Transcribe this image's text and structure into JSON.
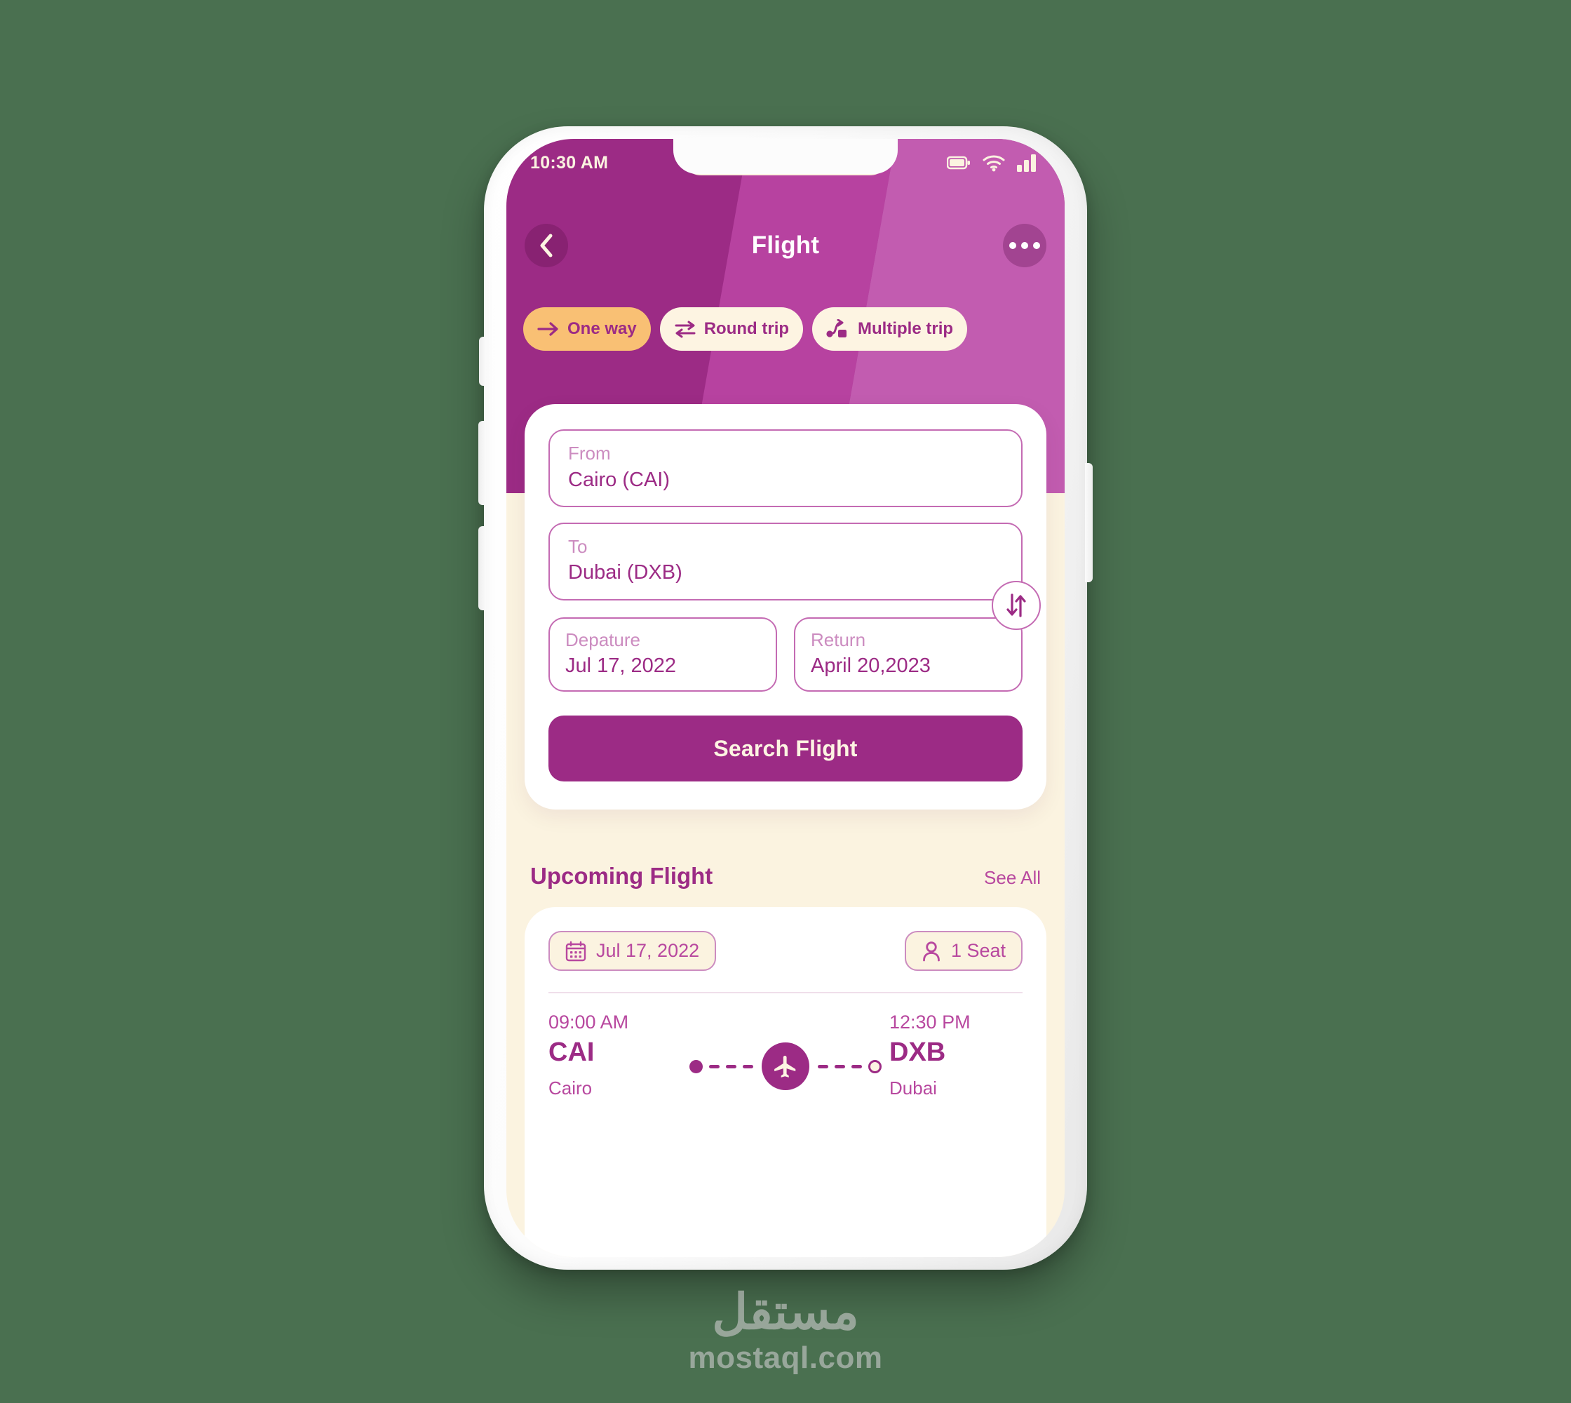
{
  "theme": {
    "page_bg": "#4a7050",
    "primary_purple": "#9c2b85",
    "band_mid": "#b742a0",
    "band_light": "#c25cb0",
    "cream": "#fbf3e0",
    "accent_orange": "#f9c074",
    "text_light_purple": "#cc8cc0"
  },
  "status_bar": {
    "time": "10:30 AM",
    "battery_icon": "battery-icon",
    "wifi_icon": "wifi-icon",
    "signal_icon": "signal-icon"
  },
  "header": {
    "back_icon": "chevron-left-icon",
    "title": "Flight",
    "menu_icon": "more-options-icon"
  },
  "trip_tabs": [
    {
      "label": "One way",
      "icon": "arrow-right-icon",
      "active": true
    },
    {
      "label": "Round trip",
      "icon": "round-trip-icon",
      "active": false
    },
    {
      "label": "Multiple trip",
      "icon": "multiple-trip-icon",
      "active": false
    }
  ],
  "search_form": {
    "from": {
      "label": "From",
      "value": "Cairo (CAI)"
    },
    "to": {
      "label": "To",
      "value": "Dubai (DXB)"
    },
    "swap_icon": "swap-vertical-icon",
    "departure": {
      "label": "Depature",
      "value": "Jul 17, 2022"
    },
    "return": {
      "label": "Return",
      "value": "April 20,2023"
    },
    "submit_label": "Search Flight"
  },
  "upcoming": {
    "title": "Upcoming Flight",
    "see_all": "See All",
    "flight": {
      "date_chip": {
        "icon": "calendar-icon",
        "label": "Jul 17, 2022"
      },
      "seat_chip": {
        "icon": "person-icon",
        "label": "1 Seat"
      },
      "origin": {
        "time": "09:00 AM",
        "code": "CAI",
        "city": "Cairo"
      },
      "destination": {
        "time": "12:30 PM",
        "code": "DXB",
        "city": "Dubai"
      },
      "route_icon": "airplane-icon"
    }
  },
  "watermark": {
    "arabic": "مستقل",
    "latin": "mostaql.com"
  }
}
